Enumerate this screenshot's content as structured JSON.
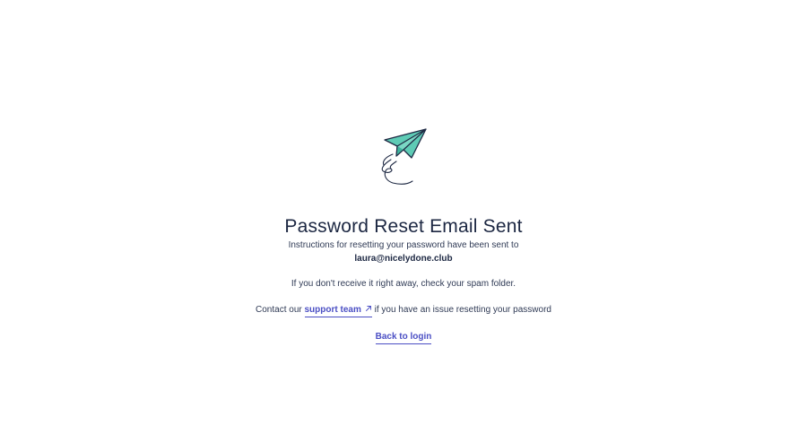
{
  "illustration": {
    "icon": "paper-plane-icon",
    "plane_color": "#5ecbb5",
    "stroke_color": "#1f2a44"
  },
  "title": "Password Reset Email Sent",
  "instructions": "Instructions for resetting your password have been sent to",
  "email": "laura@nicelydone.club",
  "spam_notice": "If you don't receive it right away, check your spam folder.",
  "contact": {
    "prefix": "Contact our",
    "link_label": "support team",
    "suffix": "if you have an issue resetting your password",
    "link_icon": "external-link-icon"
  },
  "back_link": "Back to login",
  "colors": {
    "text": "#1c2742",
    "link": "#4b4fc4",
    "accent": "#5ecbb5"
  }
}
